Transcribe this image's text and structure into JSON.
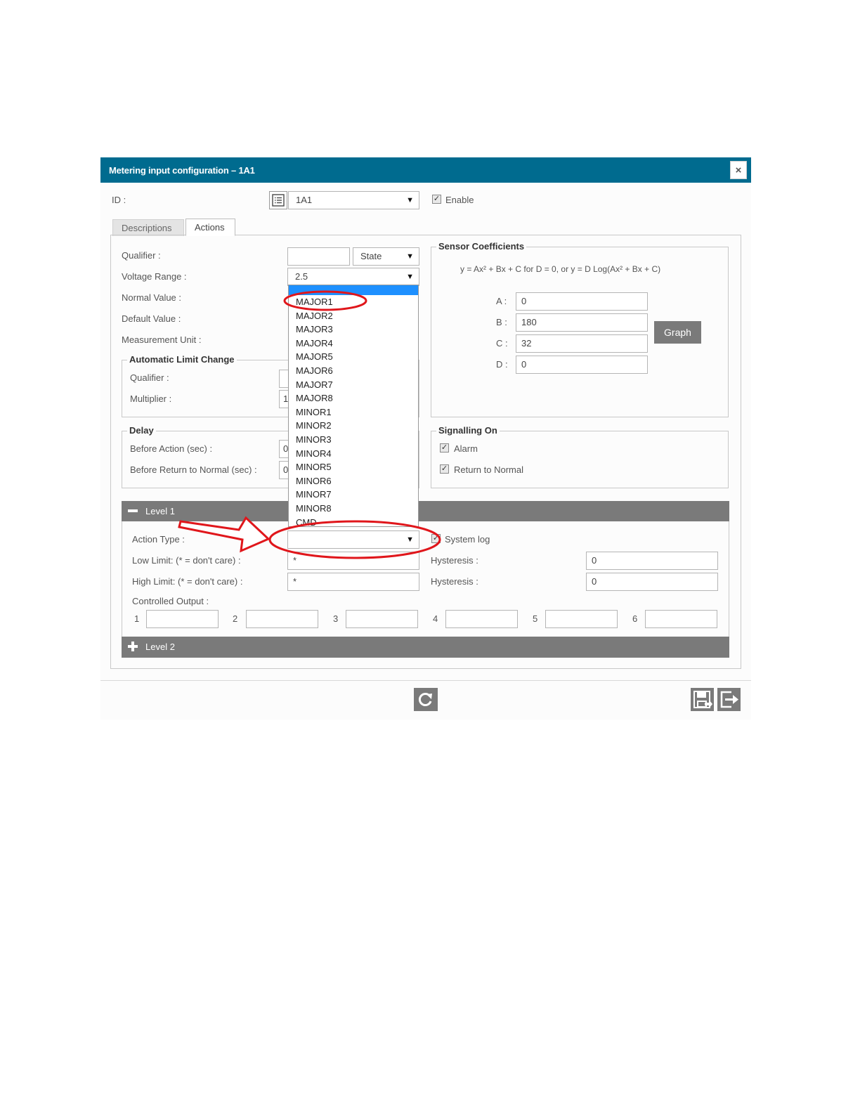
{
  "dialog": {
    "title": "Metering input configuration – 1A1",
    "close": "×"
  },
  "header": {
    "id_label": "ID :",
    "id_value": "1A1",
    "enable_label": "Enable"
  },
  "tabs": [
    {
      "label": "Descriptions"
    },
    {
      "label": "Actions"
    }
  ],
  "left": {
    "qualifier_label": "Qualifier :",
    "qualifier_value": "",
    "qualifier_select": "State",
    "voltage_range_label": "Voltage Range :",
    "voltage_range_value": "2.5",
    "normal_value_label": "Normal Value :",
    "default_value_label": "Default Value :",
    "measurement_unit_label": "Measurement Unit :"
  },
  "auto_limit": {
    "legend": "Automatic Limit Change",
    "qualifier_label": "Qualifier :",
    "multiplier_label": "Multiplier :",
    "multiplier_value": "1"
  },
  "delay": {
    "legend": "Delay",
    "before_action_label": "Before Action (sec) :",
    "before_action_value": "0",
    "before_return_label": "Before Return to Normal (sec) :",
    "before_return_value": "0"
  },
  "sensor": {
    "legend": "Sensor Coefficients",
    "formula": "y = Ax² + Bx + C for D = 0, or y = D Log(Ax² + Bx + C)",
    "a_label": "A :",
    "a_value": "0",
    "b_label": "B :",
    "b_value": "180",
    "c_label": "C :",
    "c_value": "32",
    "d_label": "D :",
    "d_value": "0",
    "graph_label": "Graph"
  },
  "signalling": {
    "legend": "Signalling On",
    "alarm_label": "Alarm",
    "return_label": "Return to Normal"
  },
  "level1": {
    "toggle": "−",
    "title": "Level 1",
    "action_type_label": "Action Type :",
    "action_type_value": "",
    "system_log_label": "System log",
    "low_limit_label": "Low Limit: (* = don't care) :",
    "low_limit_value": "*",
    "high_limit_label": "High Limit: (* = don't care) :",
    "high_limit_value": "*",
    "hysteresis_label": "Hysteresis :",
    "hysteresis_low_value": "0",
    "hysteresis_high_value": "0",
    "controlled_output_label": "Controlled Output :",
    "outputs": [
      "1",
      "2",
      "3",
      "4",
      "5",
      "6"
    ]
  },
  "level2": {
    "toggle": "+",
    "title": "Level 2"
  },
  "dropdown_options": [
    "MAJOR1",
    "MAJOR2",
    "MAJOR3",
    "MAJOR4",
    "MAJOR5",
    "MAJOR6",
    "MAJOR7",
    "MAJOR8",
    "MINOR1",
    "MINOR2",
    "MINOR3",
    "MINOR4",
    "MINOR5",
    "MINOR6",
    "MINOR7",
    "MINOR8",
    "CMD"
  ],
  "colors": {
    "titlebar": "#006b8f",
    "level_bar": "#7a7a7a",
    "dropdown_highlight": "#1e90ff",
    "annotation": "#e0161b"
  },
  "icons": {
    "refresh": "refresh-icon",
    "save": "save-icon",
    "exit": "exit-icon",
    "list": "list-icon"
  }
}
